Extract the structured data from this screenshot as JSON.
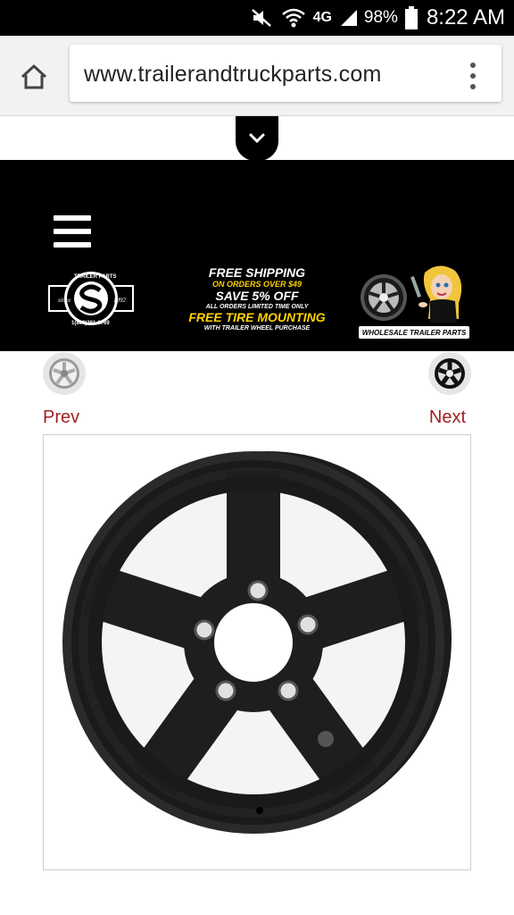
{
  "status_bar": {
    "network": "4G",
    "battery": "98%",
    "time": "8:22 AM"
  },
  "browser": {
    "url": "www.trailerandtruckparts.com"
  },
  "header": {
    "logo": {
      "arc_text": "TRAILER PARTS",
      "since": "since",
      "year": "1992",
      "phone": "1(800)281-2769"
    },
    "promo": {
      "line1": "FREE SHIPPING",
      "line2": "ON ORDERS OVER $49",
      "line3": "SAVE 5% OFF",
      "line4": "ALL ORDERS LIMITED TIME ONLY",
      "line5": "FREE TIRE MOUNTING",
      "line6": "WITH TRAILER WHEEL PURCHASE"
    },
    "wholesale_label": "WHOLESALE TRAILER PARTS"
  },
  "nav": {
    "prev": "Prev",
    "next": "Next"
  },
  "colors": {
    "link": "#a02020",
    "promo_accent": "#ffd200",
    "header_bg": "#000000"
  }
}
